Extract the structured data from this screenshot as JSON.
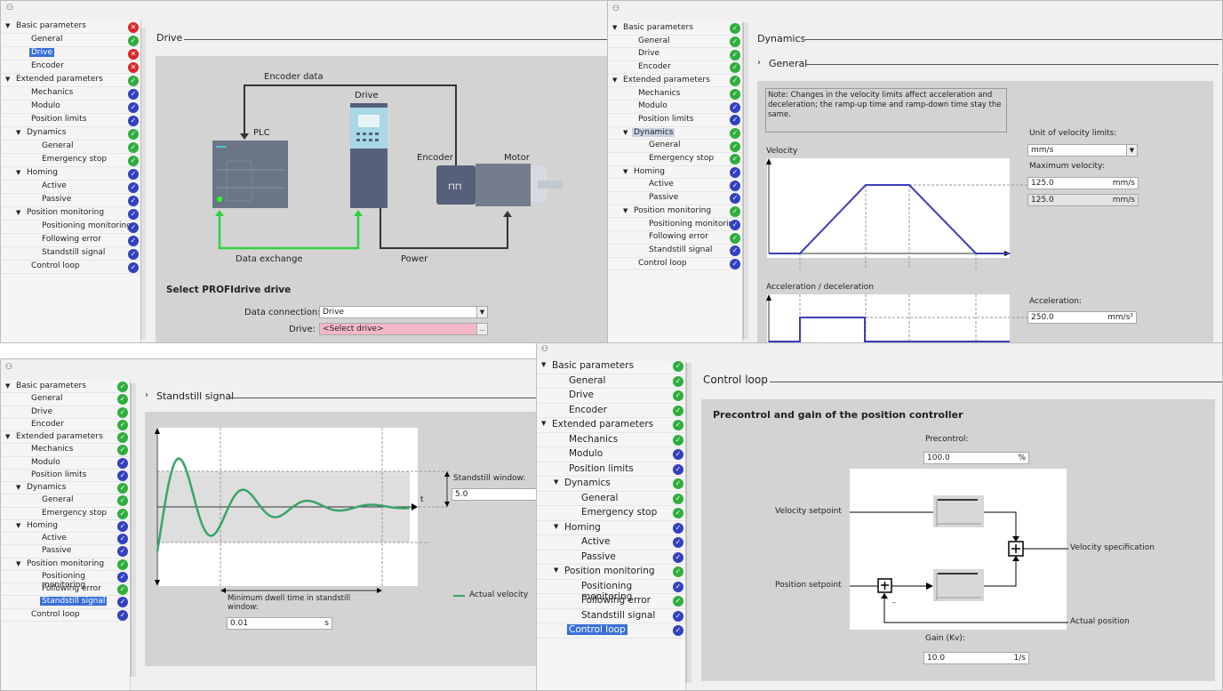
{
  "tree_labels": [
    {
      "label": "Basic parameters",
      "level": 0,
      "expand": true
    },
    {
      "label": "General",
      "level": 1
    },
    {
      "label": "Drive",
      "level": 1
    },
    {
      "label": "Encoder",
      "level": 1
    },
    {
      "label": "Extended parameters",
      "level": 0,
      "expand": true
    },
    {
      "label": "Mechanics",
      "level": 1
    },
    {
      "label": "Modulo",
      "level": 1
    },
    {
      "label": "Position limits",
      "level": 1
    },
    {
      "label": "Dynamics",
      "level": 1,
      "expand": true
    },
    {
      "label": "General",
      "level": 2
    },
    {
      "label": "Emergency stop",
      "level": 2
    },
    {
      "label": "Homing",
      "level": 1,
      "expand": true
    },
    {
      "label": "Active",
      "level": 2
    },
    {
      "label": "Passive",
      "level": 2
    },
    {
      "label": "Position monitoring",
      "level": 1,
      "expand": true
    },
    {
      "label": "Positioning monitoring",
      "level": 2
    },
    {
      "label": "Following error",
      "level": 2
    },
    {
      "label": "Standstill signal",
      "level": 2
    },
    {
      "label": "Control loop",
      "level": 1
    }
  ],
  "status_colors": {
    "ok": "#2fae3e",
    "info": "#3340c0",
    "error": "#d8262c"
  },
  "panels": {
    "drive": {
      "statuses": [
        "error",
        "ok",
        "error",
        "error",
        "ok",
        "info",
        "info",
        "info",
        "ok",
        "ok",
        "ok",
        "info",
        "info",
        "info",
        "info",
        "info",
        "info",
        "info",
        "info"
      ],
      "selected": 2,
      "section_title": "Drive",
      "diagram": {
        "encoder_data": "Encoder data",
        "drive": "Drive",
        "plc": "PLC",
        "encoder": "Encoder",
        "motor": "Motor",
        "data_exchange": "Data exchange",
        "power": "Power"
      },
      "form_title": "Select PROFIdrive drive",
      "data_connection_label": "Data connection:",
      "data_connection_value": "Drive",
      "drive_label": "Drive:",
      "drive_value": "<Select drive>",
      "browse": "..."
    },
    "dynamics": {
      "statuses": [
        "ok",
        "ok",
        "ok",
        "ok",
        "ok",
        "ok",
        "info",
        "info",
        "ok",
        "ok",
        "ok",
        "info",
        "info",
        "info",
        "ok",
        "info",
        "ok",
        "info",
        "info"
      ],
      "highlighted": 8,
      "section_title": "Dynamics",
      "subsection_title": "General",
      "note": "Note: Changes in the velocity limits affect acceleration and deceleration; the ramp-up time and ramp-down time stay the same.",
      "velocity_chart_label": "Velocity",
      "accel_chart_label": "Acceleration / deceleration",
      "unit_label": "Unit of velocity limits:",
      "unit_value": "mm/s",
      "max_velocity_label": "Maximum velocity:",
      "max_velocity_value": "125.0",
      "max_velocity_unit": "mm/s",
      "velocity_readonly_value": "125.0",
      "velocity_readonly_unit": "mm/s",
      "acceleration_label": "Acceleration:",
      "acceleration_value": "250.0",
      "acceleration_unit": "mm/s²"
    },
    "standstill": {
      "statuses": [
        "ok",
        "ok",
        "ok",
        "ok",
        "ok",
        "ok",
        "info",
        "info",
        "ok",
        "ok",
        "ok",
        "info",
        "info",
        "info",
        "ok",
        "info",
        "ok",
        "info",
        "info"
      ],
      "selected": 17,
      "section_title": "Standstill signal",
      "axis_label": "t",
      "window_label": "Standstill window:",
      "window_value": "5.0",
      "dwell_label": "Minimum dwell time in standstill window:",
      "dwell_value": "0.01",
      "dwell_unit": "s",
      "legend": "Actual velocity",
      "curve_color": "#3aa36a"
    },
    "control_loop": {
      "statuses": [
        "ok",
        "ok",
        "ok",
        "ok",
        "ok",
        "ok",
        "info",
        "info",
        "ok",
        "ok",
        "ok",
        "info",
        "info",
        "info",
        "ok",
        "info",
        "ok",
        "info",
        "info"
      ],
      "selected": 18,
      "section_title": "Control loop",
      "form_title": "Precontrol and gain of the position controller",
      "precontrol_label": "Precontrol:",
      "precontrol_value": "100.0",
      "precontrol_unit": "%",
      "velocity_setpoint": "Velocity setpoint",
      "position_setpoint": "Position setpoint",
      "velocity_specification": "Velocity specification",
      "actual_position": "Actual position",
      "minus": "–",
      "gain_label": "Gain (Kv):",
      "gain_value": "10.0",
      "gain_unit": "1/s"
    }
  }
}
